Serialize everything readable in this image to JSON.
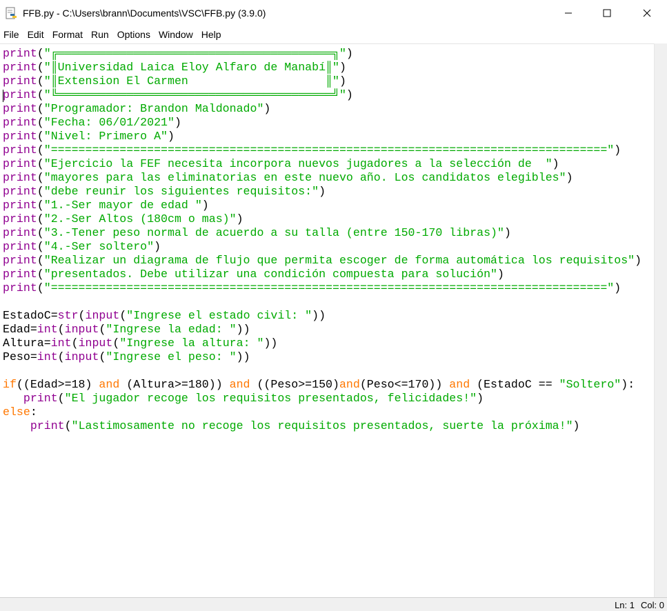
{
  "window": {
    "title": "FFB.py - C:\\Users\\brann\\Documents\\VSC\\FFB.py (3.9.0)",
    "controls": {
      "minimize": "minimize-icon",
      "maximize": "maximize-icon",
      "close": "close-icon"
    }
  },
  "menu": {
    "items": [
      "File",
      "Edit",
      "Format",
      "Run",
      "Options",
      "Window",
      "Help"
    ]
  },
  "editor": {
    "lines": [
      [
        [
          "b",
          "print"
        ],
        [
          "p",
          "("
        ],
        [
          "s",
          "\"╔════════════════════════════════════════╗\""
        ],
        [
          "p",
          ")"
        ]
      ],
      [
        [
          "b",
          "print"
        ],
        [
          "p",
          "("
        ],
        [
          "s",
          "\"║Universidad Laica Eloy Alfaro de Manabí║\""
        ],
        [
          "p",
          ")"
        ]
      ],
      [
        [
          "b",
          "print"
        ],
        [
          "p",
          "("
        ],
        [
          "s",
          "\"║Extension El Carmen                    ║\""
        ],
        [
          "p",
          ")"
        ]
      ],
      [
        [
          "b",
          "print"
        ],
        [
          "p",
          "("
        ],
        [
          "s",
          "\"╚════════════════════════════════════════╝\""
        ],
        [
          "p",
          ")"
        ]
      ],
      [
        [
          "b",
          "print"
        ],
        [
          "p",
          "("
        ],
        [
          "s",
          "\"Programador: Brandon Maldonado\""
        ],
        [
          "p",
          ")"
        ]
      ],
      [
        [
          "b",
          "print"
        ],
        [
          "p",
          "("
        ],
        [
          "s",
          "\"Fecha: 06/01/2021\""
        ],
        [
          "p",
          ")"
        ]
      ],
      [
        [
          "b",
          "print"
        ],
        [
          "p",
          "("
        ],
        [
          "s",
          "\"Nivel: Primero A\""
        ],
        [
          "p",
          ")"
        ]
      ],
      [
        [
          "b",
          "print"
        ],
        [
          "p",
          "("
        ],
        [
          "s",
          "\"=================================================================================\""
        ],
        [
          "p",
          ")"
        ]
      ],
      [
        [
          "b",
          "print"
        ],
        [
          "p",
          "("
        ],
        [
          "s",
          "\"Ejercicio la FEF necesita incorpora nuevos jugadores a la selección de  \""
        ],
        [
          "p",
          ")"
        ]
      ],
      [
        [
          "b",
          "print"
        ],
        [
          "p",
          "("
        ],
        [
          "s",
          "\"mayores para las eliminatorias en este nuevo año. Los candidatos elegibles\""
        ],
        [
          "p",
          ")"
        ]
      ],
      [
        [
          "b",
          "print"
        ],
        [
          "p",
          "("
        ],
        [
          "s",
          "\"debe reunir los siguientes requisitos:\""
        ],
        [
          "p",
          ")"
        ]
      ],
      [
        [
          "b",
          "print"
        ],
        [
          "p",
          "("
        ],
        [
          "s",
          "\"1.-Ser mayor de edad \""
        ],
        [
          "p",
          ")"
        ]
      ],
      [
        [
          "b",
          "print"
        ],
        [
          "p",
          "("
        ],
        [
          "s",
          "\"2.-Ser Altos (180cm o mas)\""
        ],
        [
          "p",
          ")"
        ]
      ],
      [
        [
          "b",
          "print"
        ],
        [
          "p",
          "("
        ],
        [
          "s",
          "\"3.-Tener peso normal de acuerdo a su talla (entre 150-170 libras)\""
        ],
        [
          "p",
          ")"
        ]
      ],
      [
        [
          "b",
          "print"
        ],
        [
          "p",
          "("
        ],
        [
          "s",
          "\"4.-Ser soltero\""
        ],
        [
          "p",
          ")"
        ]
      ],
      [
        [
          "b",
          "print"
        ],
        [
          "p",
          "("
        ],
        [
          "s",
          "\"Realizar un diagrama de flujo que permita escoger de forma automática los requisitos\""
        ],
        [
          "p",
          ")"
        ]
      ],
      [
        [
          "b",
          "print"
        ],
        [
          "p",
          "("
        ],
        [
          "s",
          "\"presentados. Debe utilizar una condición compuesta para solución\""
        ],
        [
          "p",
          ")"
        ]
      ],
      [
        [
          "b",
          "print"
        ],
        [
          "p",
          "("
        ],
        [
          "s",
          "\"=================================================================================\""
        ],
        [
          "p",
          ")"
        ]
      ],
      [],
      [
        [
          "p",
          "EstadoC="
        ],
        [
          "b",
          "str"
        ],
        [
          "p",
          "("
        ],
        [
          "b",
          "input"
        ],
        [
          "p",
          "("
        ],
        [
          "s",
          "\"Ingrese el estado civil: \""
        ],
        [
          "p",
          "))"
        ]
      ],
      [
        [
          "p",
          "Edad="
        ],
        [
          "b",
          "int"
        ],
        [
          "p",
          "("
        ],
        [
          "b",
          "input"
        ],
        [
          "p",
          "("
        ],
        [
          "s",
          "\"Ingrese la edad: \""
        ],
        [
          "p",
          "))"
        ]
      ],
      [
        [
          "p",
          "Altura="
        ],
        [
          "b",
          "int"
        ],
        [
          "p",
          "("
        ],
        [
          "b",
          "input"
        ],
        [
          "p",
          "("
        ],
        [
          "s",
          "\"Ingrese la altura: \""
        ],
        [
          "p",
          "))"
        ]
      ],
      [
        [
          "p",
          "Peso="
        ],
        [
          "b",
          "int"
        ],
        [
          "p",
          "("
        ],
        [
          "b",
          "input"
        ],
        [
          "p",
          "("
        ],
        [
          "s",
          "\"Ingrese el peso: \""
        ],
        [
          "p",
          "))"
        ]
      ],
      [],
      [
        [
          "k",
          "if"
        ],
        [
          "p",
          "((Edad>=18) "
        ],
        [
          "k",
          "and"
        ],
        [
          "p",
          " (Altura>=180)) "
        ],
        [
          "k",
          "and"
        ],
        [
          "p",
          " ((Peso>=150)"
        ],
        [
          "k",
          "and"
        ],
        [
          "p",
          "(Peso<=170)) "
        ],
        [
          "k",
          "and"
        ],
        [
          "p",
          " (EstadoC == "
        ],
        [
          "s",
          "\"Soltero\""
        ],
        [
          "p",
          "):"
        ]
      ],
      [
        [
          "p",
          "   "
        ],
        [
          "b",
          "print"
        ],
        [
          "p",
          "("
        ],
        [
          "s",
          "\"El jugador recoge los requisitos presentados, felicidades!\""
        ],
        [
          "p",
          ")"
        ]
      ],
      [
        [
          "k",
          "else"
        ],
        [
          "p",
          ":"
        ]
      ],
      [
        [
          "p",
          "    "
        ],
        [
          "b",
          "print"
        ],
        [
          "p",
          "("
        ],
        [
          "s",
          "\"Lastimosamente no recoge los requisitos presentados, suerte la próxima!\""
        ],
        [
          "p",
          ")"
        ]
      ]
    ]
  },
  "status": {
    "line": "Ln: 1",
    "col": "Col: 0"
  }
}
